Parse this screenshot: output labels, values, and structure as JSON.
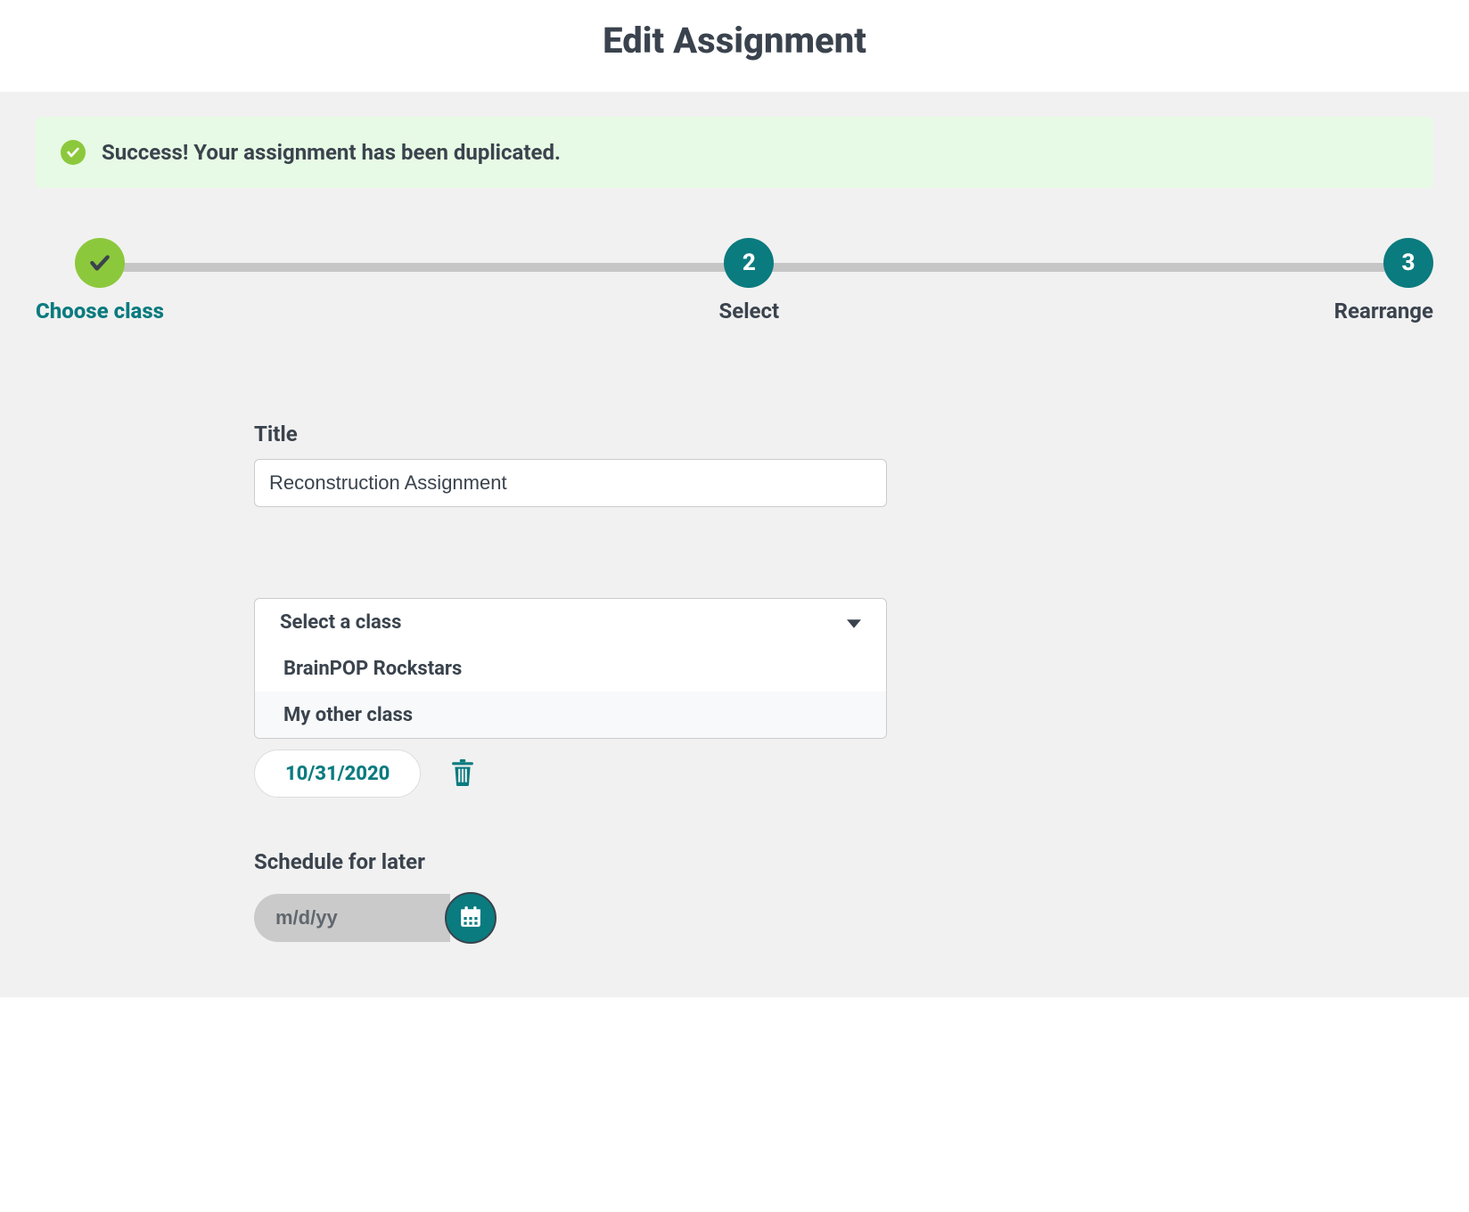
{
  "header": {
    "title": "Edit Assignment"
  },
  "alert": {
    "text": "Success! Your assignment has been duplicated."
  },
  "stepper": {
    "steps": [
      {
        "num": "✓",
        "label": "Choose class",
        "state": "done",
        "active": true
      },
      {
        "num": "2",
        "label": "Select",
        "state": "todo",
        "active": false
      },
      {
        "num": "3",
        "label": "Rearrange",
        "state": "todo",
        "active": false
      }
    ]
  },
  "form": {
    "title_label": "Title",
    "title_value": "Reconstruction Assignment",
    "class_select": {
      "placeholder": "Select a class",
      "options": [
        "BrainPOP Rockstars",
        "My other class"
      ]
    },
    "due_date": "10/31/2020",
    "schedule_label": "Schedule for later",
    "schedule_placeholder": "m/d/yy"
  },
  "colors": {
    "teal": "#0a7b7f",
    "green": "#8cc83c",
    "bg": "#f1f1f1",
    "text": "#3a434d"
  }
}
